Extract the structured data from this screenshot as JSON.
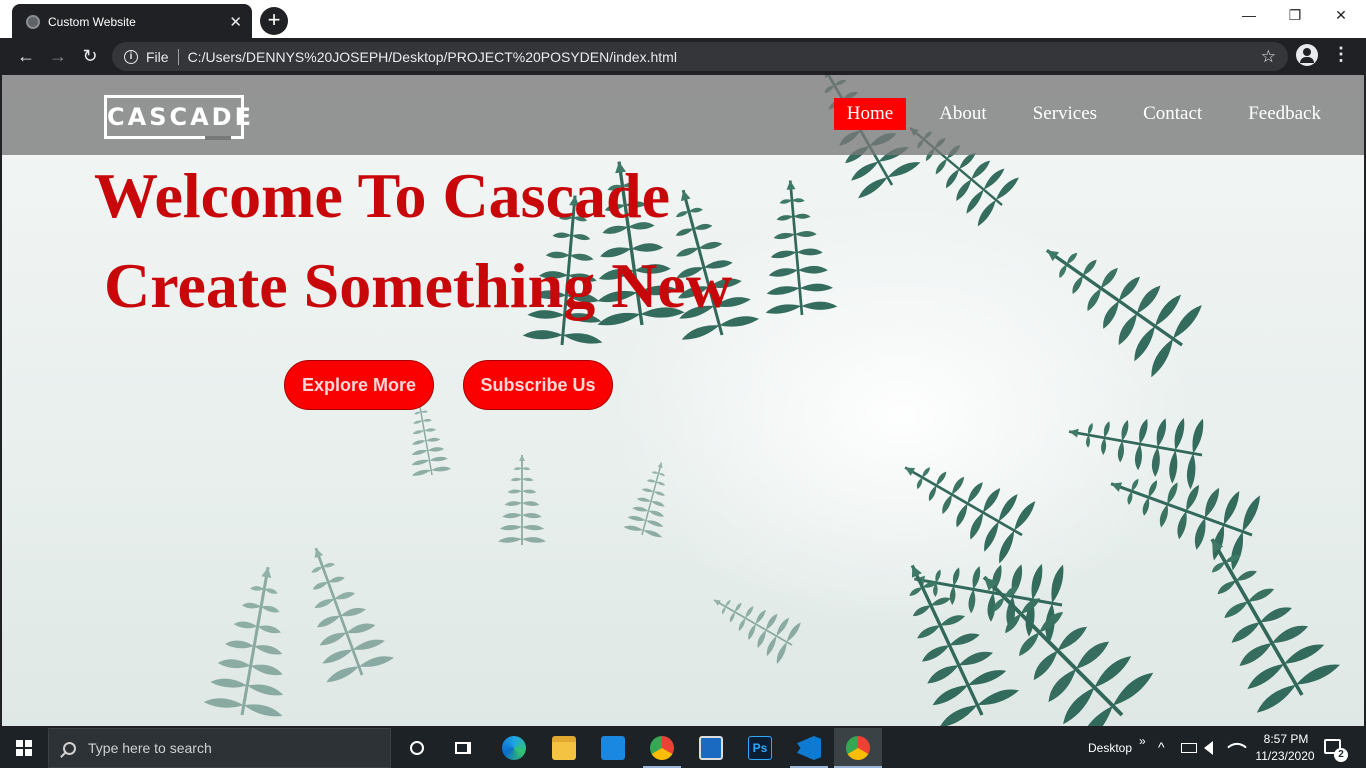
{
  "browser": {
    "tab_title": "Custom Website",
    "tab_close": "✕",
    "new_tab": "+",
    "window_controls": {
      "minimize": "—",
      "maximize": "❐",
      "close": "✕"
    },
    "address": {
      "back": "←",
      "forward": "→",
      "reload": "↻",
      "protocol_label": "File",
      "url": "C:/Users/DENNYS%20JOSEPH/Desktop/PROJECT%20POSYDEN/index.html",
      "bookmark": "☆"
    },
    "menu": "⋮"
  },
  "site": {
    "logo": "CASCADE",
    "nav": [
      {
        "label": "Home",
        "active": true
      },
      {
        "label": "About",
        "active": false
      },
      {
        "label": "Services",
        "active": false
      },
      {
        "label": "Contact",
        "active": false
      },
      {
        "label": "Feedback",
        "active": false
      }
    ],
    "hero": {
      "line1": "Welcome To Cascade",
      "line2": "Create Something New"
    },
    "buttons": {
      "explore": "Explore More",
      "subscribe": "Subscribe Us"
    },
    "colors": {
      "accent": "#ff0000",
      "heading": "#c8070a",
      "nav_bg": "#7a7a7a"
    }
  },
  "taskbar": {
    "search_placeholder": "Type here to search",
    "apps": [
      "cortana-icon",
      "task-view-icon",
      "edge-icon",
      "file-explorer-icon",
      "mail-icon",
      "chrome-icon",
      "lenovo-icon",
      "photoshop-icon",
      "vscode-icon",
      "chrome-icon"
    ],
    "photoshop_label": "Ps",
    "desktop_label": "Desktop",
    "chevrons": "»",
    "tray_up": "^",
    "time": "8:57 PM",
    "date": "11/23/2020",
    "notifications_count": "2"
  }
}
